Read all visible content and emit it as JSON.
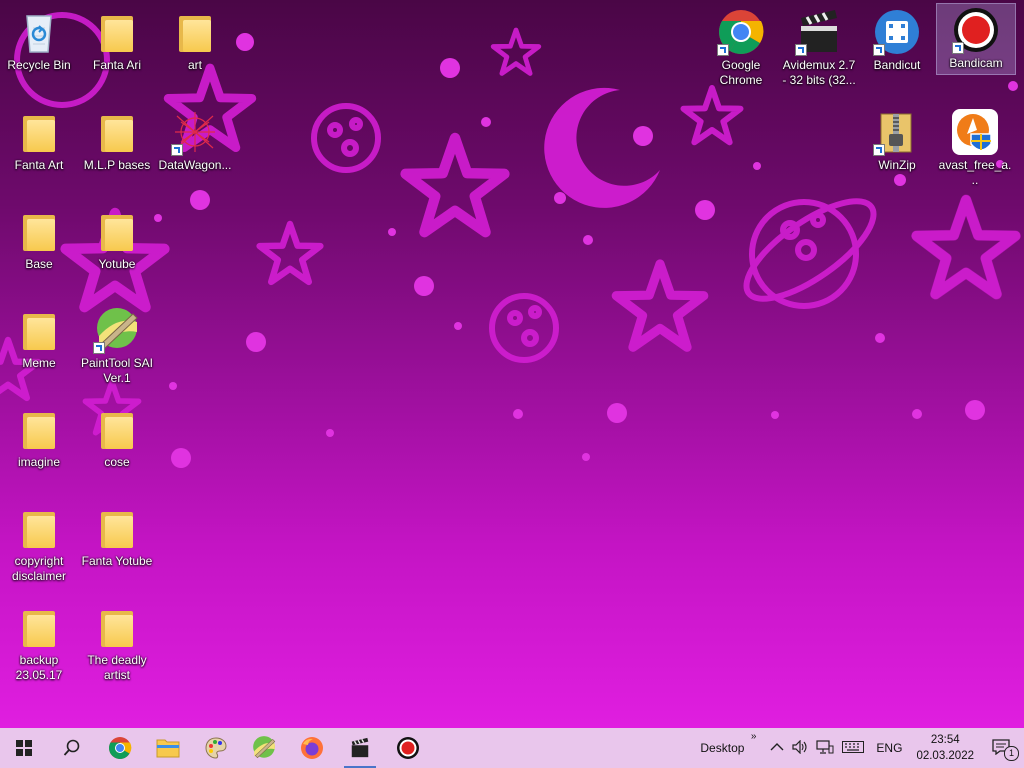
{
  "desktop": {
    "icons": [
      {
        "label": "Recycle Bin"
      },
      {
        "label": "Fanta Art"
      },
      {
        "label": "Base"
      },
      {
        "label": "Meme"
      },
      {
        "label": "imagine"
      },
      {
        "label": "copyright disclaimer"
      },
      {
        "label": "backup 23.05.17"
      },
      {
        "label": "Fanta Ari"
      },
      {
        "label": "M.L.P bases"
      },
      {
        "label": "Yotube"
      },
      {
        "label": "PaintTool SAI Ver.1"
      },
      {
        "label": "cose"
      },
      {
        "label": "Fanta Yotube"
      },
      {
        "label": "The deadly artist"
      },
      {
        "label": "art"
      },
      {
        "label": "DataWagon..."
      },
      {
        "label": "Google Chrome"
      },
      {
        "label": "Avidemux 2.7 - 32 bits (32..."
      },
      {
        "label": "Bandicut"
      },
      {
        "label": "Bandicam"
      },
      {
        "label": "WinZip"
      },
      {
        "label": "avast_free_a..."
      }
    ]
  },
  "taskbar": {
    "apps": [
      {
        "icon": "windows-start-icon"
      },
      {
        "icon": "search-icon"
      },
      {
        "icon": "chrome-icon"
      },
      {
        "icon": "file-explorer-icon"
      },
      {
        "icon": "paint-palette-icon"
      },
      {
        "icon": "painttool-sai-icon"
      },
      {
        "icon": "firefox-icon"
      },
      {
        "icon": "avidemux-icon"
      },
      {
        "icon": "bandicam-icon"
      }
    ],
    "toolbar_label": "Desktop",
    "toolbar_chevron": "»",
    "language": "ENG",
    "time": "23:54",
    "date": "02.03.2022",
    "notification_count": "1"
  },
  "colors": {
    "taskbar": "#e9c6ec",
    "wallpaper_pink": "#e01ee0",
    "selection": "#c8c8ff"
  }
}
